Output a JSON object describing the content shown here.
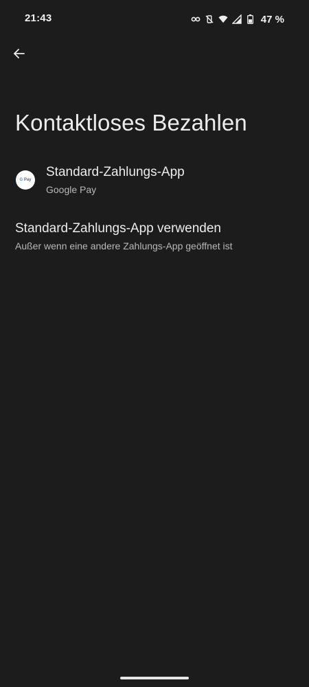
{
  "status_bar": {
    "time": "21:43",
    "battery_percent": "47 %",
    "icons": [
      "vpn-key-icon",
      "vibrate-off-icon",
      "wifi-icon",
      "signal-icon",
      "battery-icon"
    ]
  },
  "toolbar": {
    "back_icon": "arrow-back-icon"
  },
  "page": {
    "title": "Kontaktloses Bezahlen"
  },
  "preferences": [
    {
      "title": "Standard-Zahlungs-App",
      "summary": "Google Pay",
      "icon": "google-pay-icon",
      "icon_text_g": "G",
      "icon_text_pay": "Pay"
    },
    {
      "title": "Standard-Zahlungs-App verwenden",
      "summary": "Außer wenn eine andere Zahlungs-App geöffnet ist"
    }
  ],
  "colors": {
    "background": "#1c1c1c",
    "text_primary": "#ececec",
    "text_secondary": "#b9b9b9"
  }
}
